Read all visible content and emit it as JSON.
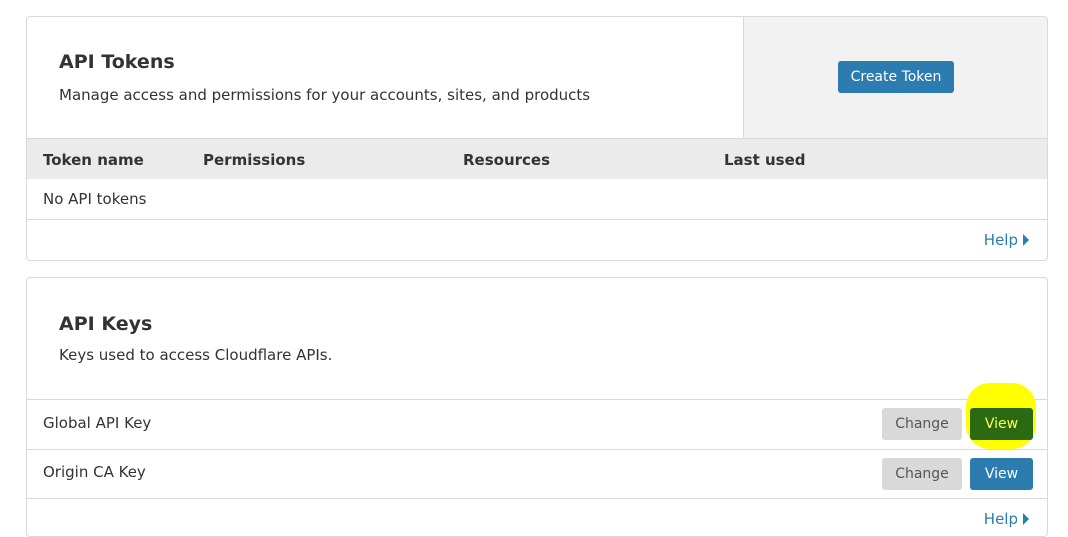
{
  "api_tokens": {
    "title": "API Tokens",
    "description": "Manage access and permissions for your accounts, sites, and products",
    "create_button": "Create Token",
    "columns": [
      "Token name",
      "Permissions",
      "Resources",
      "Last used"
    ],
    "empty_message": "No API tokens",
    "help_label": "Help"
  },
  "api_keys": {
    "title": "API Keys",
    "description": "Keys used to access Cloudflare APIs.",
    "rows": [
      {
        "name": "Global API Key",
        "change_label": "Change",
        "view_label": "View"
      },
      {
        "name": "Origin CA Key",
        "change_label": "Change",
        "view_label": "View"
      }
    ],
    "help_label": "Help"
  },
  "colors": {
    "primary": "#2c7cb0",
    "highlight": "#ffff00"
  }
}
